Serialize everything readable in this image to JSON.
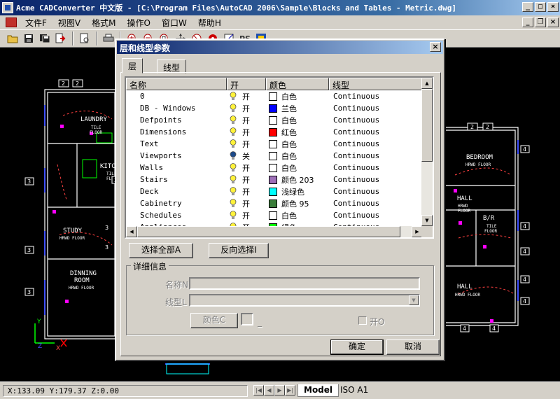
{
  "app": {
    "title": "Acme CADConverter 中文版 - [C:\\Program Files\\AutoCAD 2006\\Sample\\Blocks and Tables - Metric.dwg]",
    "minimize": "_",
    "maximize": "□",
    "close": "×",
    "restore": "❐"
  },
  "menu": [
    "文件F",
    "视图V",
    "格式M",
    "操作O",
    "窗口W",
    "帮助H"
  ],
  "toolbar_icons": [
    "open-icon",
    "save-icon",
    "save-all-icon",
    "export-icon",
    "preview-icon",
    "print-icon",
    "zoom-in-icon",
    "zoom-out-icon",
    "zoom-window-icon",
    "pan-icon",
    "layers-icon",
    "properties-icon",
    "measure-icon",
    "ps-icon",
    "settings-icon"
  ],
  "toolbar_ps": "PS",
  "drawing": {
    "labels": [
      "LAUNDRY",
      "TILE",
      "FLOOR",
      "KITCH",
      "TILE",
      "FLOO",
      "STUDY",
      "HRWD FLOOR",
      "DINNING",
      "ROOM",
      "HRWD FLOOR",
      "BEDROOM",
      "HRWD FLOOR",
      "HALL",
      "HRWD",
      "FLOOR",
      "B/R",
      "TILE",
      "FLOOR",
      "HALL",
      "HRWD FLOOR"
    ],
    "tags": [
      "2",
      "2",
      "3",
      "2",
      "3",
      "3",
      "3",
      "3",
      "2",
      "2",
      "4",
      "4",
      "4",
      "4",
      "4",
      "4",
      "4",
      "4",
      "4",
      "4",
      "4",
      "4",
      "4"
    ],
    "axis_y": "Y",
    "axis_z": "Z",
    "axis_x": "X"
  },
  "status": {
    "coords": "X:133.09 Y:179.37 Z:0.00",
    "nav": [
      "|◀",
      "◀",
      "▶",
      "▶|"
    ],
    "tab_model": "Model",
    "tab_iso": "ISO A1"
  },
  "dialog": {
    "title": "层和线型参数",
    "close": "×",
    "tabs": [
      "层",
      "线型"
    ],
    "columns": [
      "名称",
      "开",
      "颜色",
      "线型"
    ],
    "layers": [
      {
        "name": "0",
        "on": "开",
        "lit": true,
        "color_name": "白色",
        "color": "#ffffff",
        "linetype": "Continuous"
      },
      {
        "name": "DB - Windows",
        "on": "开",
        "lit": true,
        "color_name": "兰色",
        "color": "#0000ff",
        "linetype": "Continuous"
      },
      {
        "name": "Defpoints",
        "on": "开",
        "lit": true,
        "color_name": "白色",
        "color": "#ffffff",
        "linetype": "Continuous"
      },
      {
        "name": "Dimensions",
        "on": "开",
        "lit": true,
        "color_name": "红色",
        "color": "#ff0000",
        "linetype": "Continuous"
      },
      {
        "name": "Text",
        "on": "开",
        "lit": true,
        "color_name": "白色",
        "color": "#ffffff",
        "linetype": "Continuous"
      },
      {
        "name": "Viewports",
        "on": "关",
        "lit": false,
        "color_name": "白色",
        "color": "#ffffff",
        "linetype": "Continuous"
      },
      {
        "name": "Walls",
        "on": "开",
        "lit": true,
        "color_name": "白色",
        "color": "#ffffff",
        "linetype": "Continuous"
      },
      {
        "name": "Stairs",
        "on": "开",
        "lit": true,
        "color_name": "颜色 203",
        "color": "#9e6fb8",
        "linetype": "Continuous"
      },
      {
        "name": "Deck",
        "on": "开",
        "lit": true,
        "color_name": "浅绿色",
        "color": "#00ffff",
        "linetype": "Continuous"
      },
      {
        "name": "Cabinetry",
        "on": "开",
        "lit": true,
        "color_name": "颜色 95",
        "color": "#3a7d3a",
        "linetype": "Continuous"
      },
      {
        "name": "Schedules",
        "on": "开",
        "lit": true,
        "color_name": "白色",
        "color": "#ffffff",
        "linetype": "Continuous"
      },
      {
        "name": "Appliances",
        "on": "开",
        "lit": true,
        "color_name": "绿色",
        "color": "#00ff00",
        "linetype": "Continuous"
      }
    ],
    "select_all": "选择全部A",
    "invert_select": "反向选择I",
    "details_group": "详细信息",
    "name_label": "名称N",
    "linetype_label": "线型L",
    "color_button": "颜色C",
    "color_underscore": "_",
    "on_checkbox": "开O",
    "ok": "确定",
    "cancel": "取消"
  }
}
